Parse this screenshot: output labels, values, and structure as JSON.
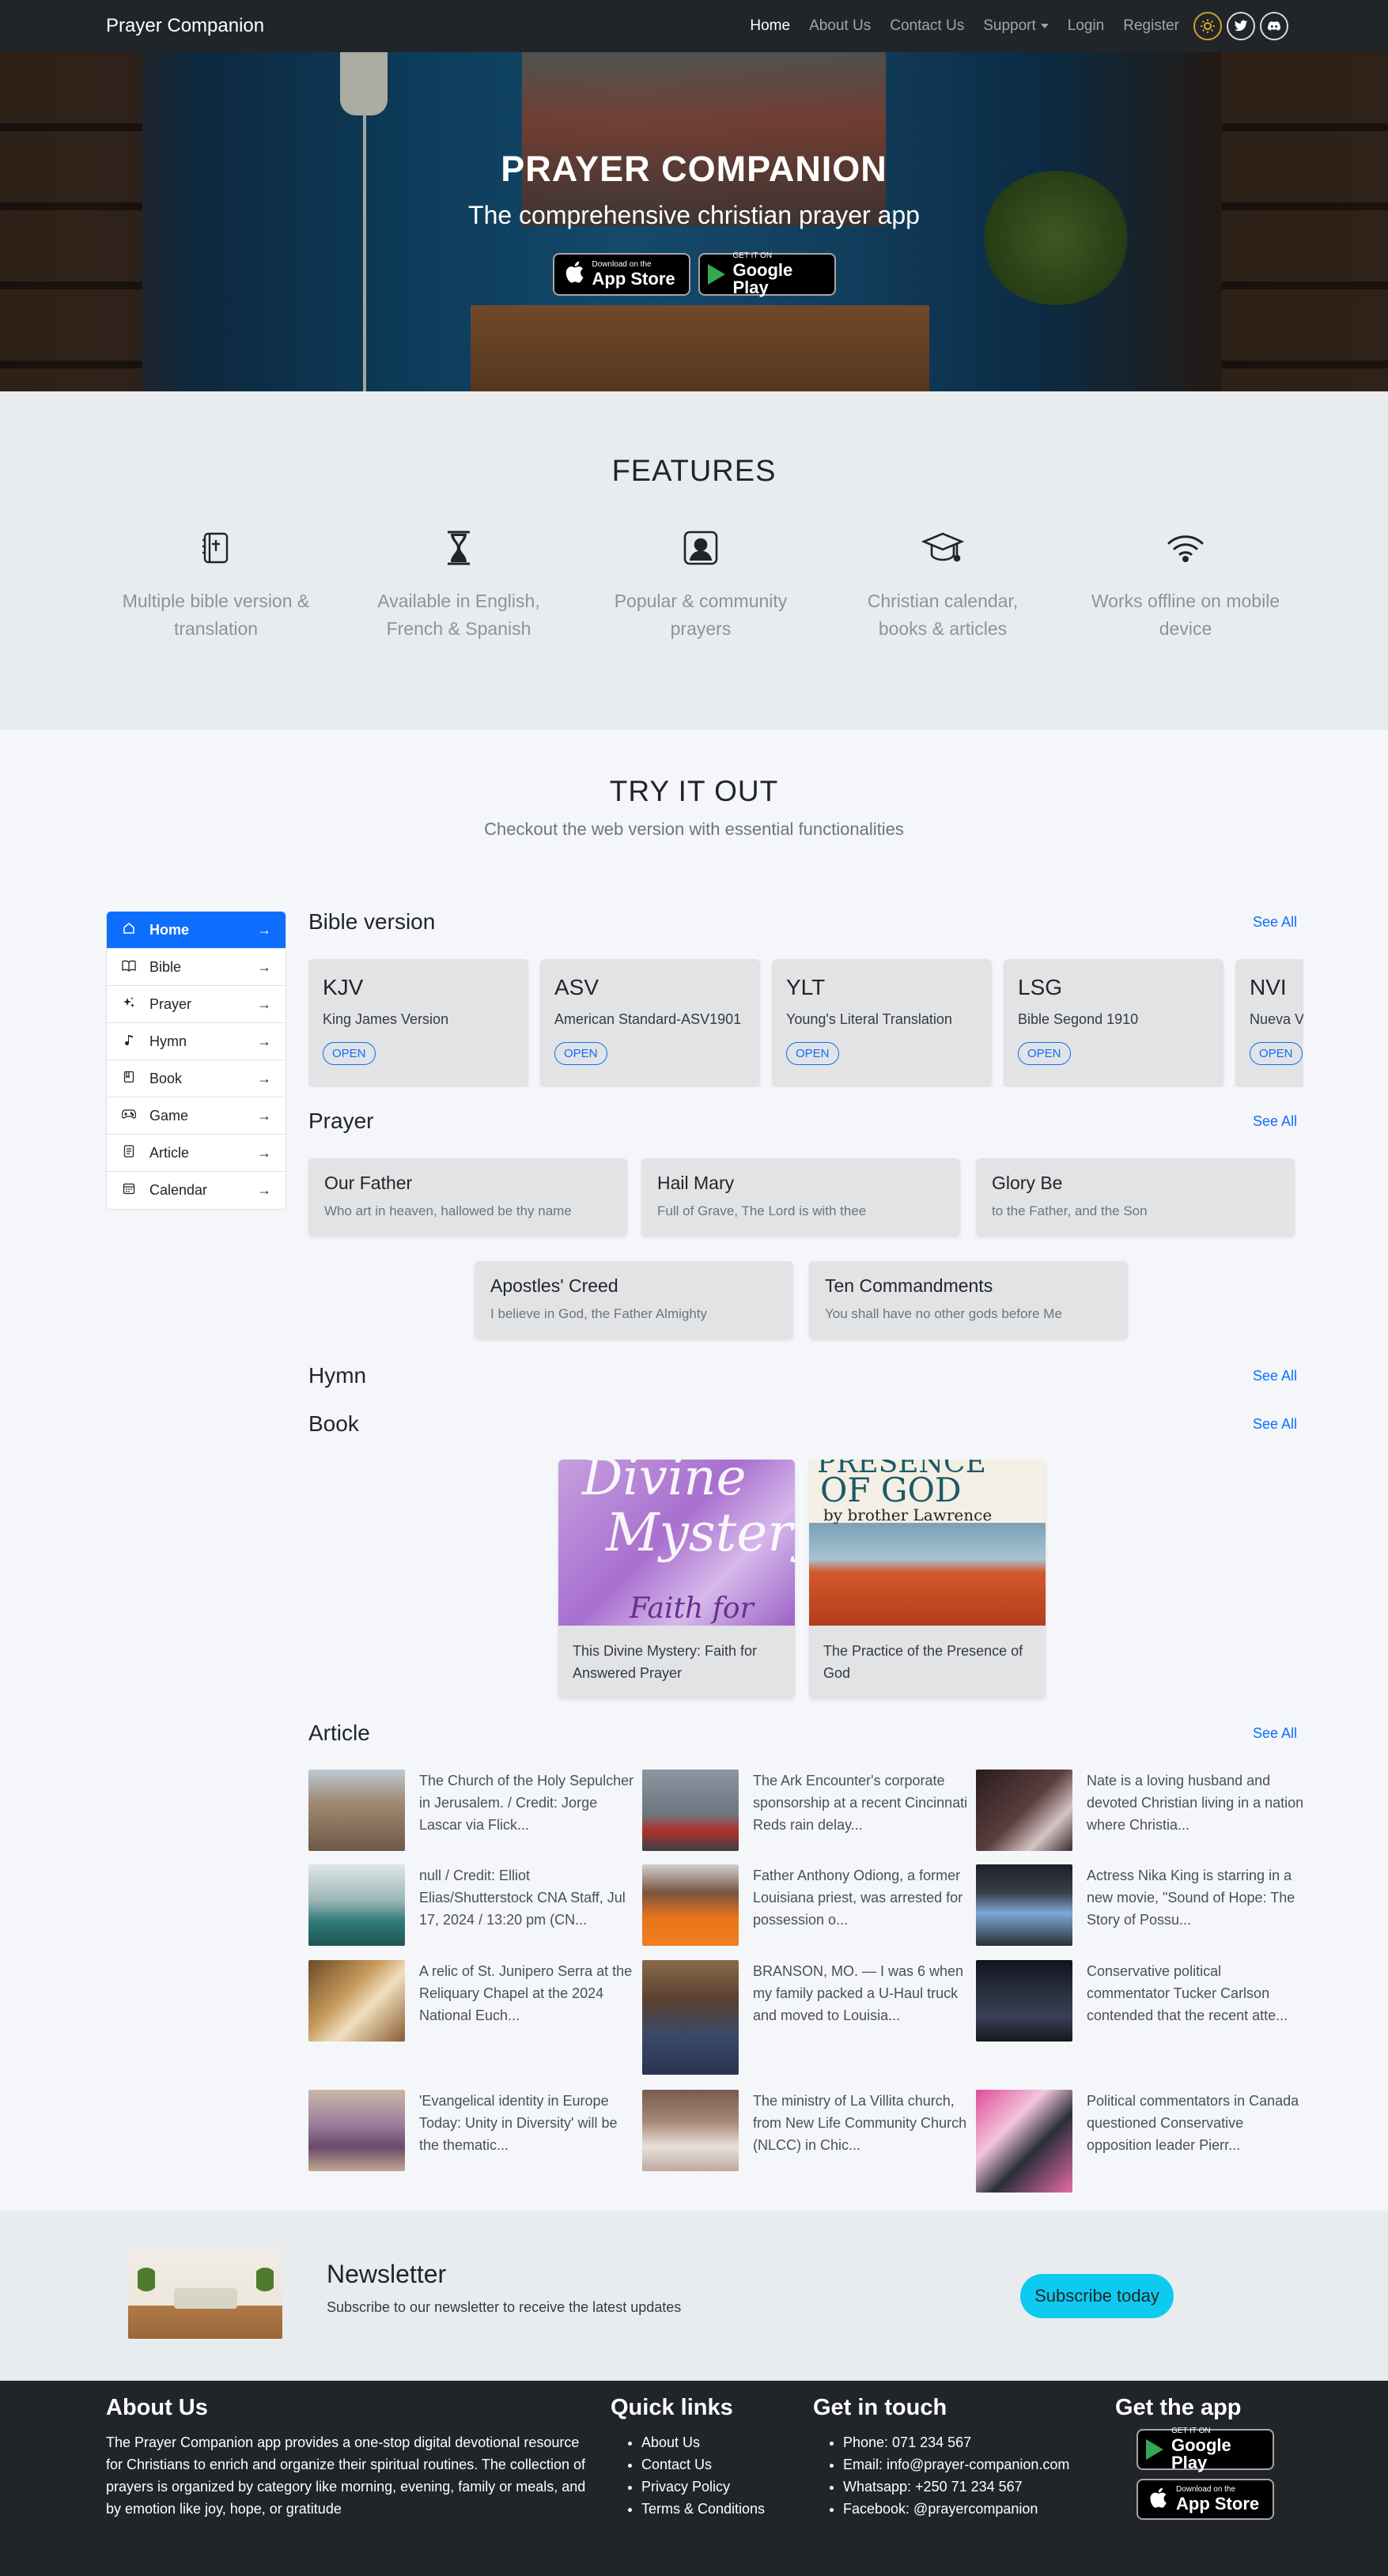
{
  "navbar": {
    "brand": "Prayer Companion",
    "links": [
      "Home",
      "About Us",
      "Contact Us",
      "Support",
      "Login",
      "Register"
    ]
  },
  "hero": {
    "title": "PRAYER COMPANION",
    "subtitle": "The comprehensive christian prayer app",
    "appstore_small": "Download on the",
    "appstore_big": "App Store",
    "googleplay_small": "GET IT ON",
    "googleplay_big": "Google Play"
  },
  "features": {
    "title": "FEATURES",
    "items": [
      {
        "icon": "bible-icon",
        "text": "Multiple bible version & translation"
      },
      {
        "icon": "hourglass-icon",
        "text": "Available in English, French & Spanish"
      },
      {
        "icon": "person-square-icon",
        "text": "Popular & community prayers"
      },
      {
        "icon": "graduation-cap-icon",
        "text": "Christian calendar, books & articles"
      },
      {
        "icon": "wifi-icon",
        "text": "Works offline on mobile device"
      }
    ]
  },
  "try": {
    "title": "TRY IT OUT",
    "subtitle": "Checkout the web version with essential functionalities"
  },
  "sidebar": {
    "items": [
      {
        "label": "Home",
        "icon": "home-icon"
      },
      {
        "label": "Bible",
        "icon": "book-open-icon"
      },
      {
        "label": "Prayer",
        "icon": "sparkles-icon"
      },
      {
        "label": "Hymn",
        "icon": "music-note-icon"
      },
      {
        "label": "Book",
        "icon": "book-icon"
      },
      {
        "label": "Game",
        "icon": "gamepad-icon"
      },
      {
        "label": "Article",
        "icon": "article-icon"
      },
      {
        "label": "Calendar",
        "icon": "calendar-icon"
      }
    ],
    "arrow": "→"
  },
  "sections": {
    "bible": "Bible version",
    "prayer": "Prayer",
    "hymn": "Hymn",
    "book": "Book",
    "article": "Article",
    "see_all": "See All"
  },
  "bibles": [
    {
      "abbr": "KJV",
      "name": "King James Version"
    },
    {
      "abbr": "ASV",
      "name": "American Standard-ASV1901"
    },
    {
      "abbr": "YLT",
      "name": "Young's Literal Translation"
    },
    {
      "abbr": "LSG",
      "name": "Bible Segond 1910"
    },
    {
      "abbr": "NVI",
      "name": "Nueva Versión Internacional"
    }
  ],
  "open_label": "OPEN",
  "prayers": [
    {
      "title": "Our Father",
      "desc": "Who art in heaven, hallowed be thy name"
    },
    {
      "title": "Hail Mary",
      "desc": "Full of Grave, The Lord is with thee"
    },
    {
      "title": "Glory Be",
      "desc": "to the Father, and the Son"
    },
    {
      "title": "Apostles' Creed",
      "desc": "I believe in God, the Father Almighty"
    },
    {
      "title": "Ten Commandments",
      "desc": "You shall have no other gods before Me"
    }
  ],
  "books": [
    {
      "title": "This Divine Mystery: Faith for Answered Prayer",
      "cover_text_1": "Divine",
      "cover_text_2": "Mystery",
      "cover_text_3": "Faith for"
    },
    {
      "title": "The Practice of the Presence of God",
      "cover_text_1": "PRESENCE",
      "cover_text_2": "OF GOD",
      "cover_text_3": "by brother Lawrence"
    }
  ],
  "articles": [
    "The Church of the Holy Sepulcher in Jerusalem. / Credit: Jorge Lascar via Flick...",
    "The Ark Encounter's corporate sponsorship at a recent Cincinnati Reds rain delay...",
    "Nate is a loving husband and devoted Christian living in a nation where Christia...",
    "null / Credit: Elliot Elias/Shutterstock CNA Staff, Jul 17, 2024 / 13:20 pm (CN...",
    "Father Anthony Odiong, a former Louisiana priest, was arrested for possession o...",
    "Actress Nika King is starring in a new movie, \"Sound of Hope: The Story of Possu...",
    "A relic of St. Junipero Serra at the Reliquary Chapel at the 2024 National Euch...",
    "BRANSON, MO. — I was 6 when my family packed a U-Haul truck and moved to Louisia...",
    "Conservative political commentator Tucker Carlson contended that the recent atte...",
    "'Evangelical identity in Europe Today: Unity in Diversity' will be the thematic...",
    "The ministry of La Villita church, from New Life Community Church (NLCC) in Chic...",
    "Political commentators in Canada questioned Conservative opposition leader Pierr..."
  ],
  "newsletter": {
    "title": "Newsletter",
    "subtitle": "Subscribe to our newsletter to receive the latest updates",
    "button": "Subscribe today"
  },
  "footer": {
    "about_title": "About Us",
    "about_text": "The Prayer Companion app provides a one-stop digital devotional resource for Christians to enrich and organize their spiritual routines. The collection of prayers is organized by category like morning, evening, family or meals, and by emotion like joy, hope, or gratitude",
    "quick_title": "Quick links",
    "quick_links": [
      "About Us",
      "Contact Us",
      "Privacy Policy",
      "Terms & Conditions"
    ],
    "touch_title": "Get in touch",
    "touch_items": [
      "Phone: 071 234 567",
      "Email: info@prayer-companion.com",
      "Whatsapp: +250 71 234 567",
      "Facebook: @prayercompanion"
    ],
    "app_title": "Get the app"
  }
}
